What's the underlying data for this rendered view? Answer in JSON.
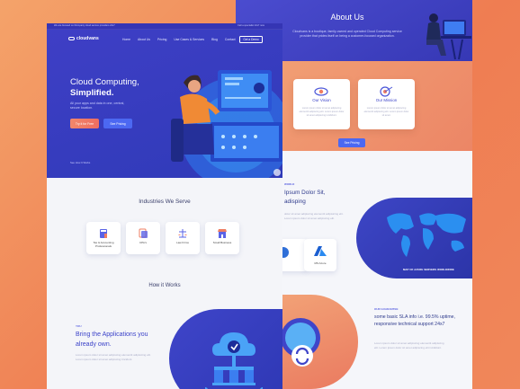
{
  "colors": {
    "primary": "#3b3fc3",
    "accent_orange": "#ee7a62",
    "button_blue": "#4c68f2",
    "background_gradient_start": "#f4a36a"
  },
  "page_a": {
    "topbar": {
      "left_text": "We are focused on third-party cloud service providers 24x7",
      "right_text": "Call a specialist 24x7 now"
    },
    "logo": "cloudvans",
    "nav": [
      "Home",
      "About Us",
      "Pricing",
      "Use Cases & Services",
      "Blog",
      "Contact"
    ],
    "nav_cta": "Get a Demo",
    "hero": {
      "title_line1": "Cloud Computing,",
      "title_line2": "Simplified.",
      "subtitle": "All your apps and data in one, central, secure location.",
      "primary_btn": "Try it for Free",
      "secondary_btn": "See Pricing",
      "see_how": "See How It Works"
    },
    "industries": {
      "title": "Industries We Serve",
      "items": [
        {
          "label": "Tax & Accounting Professionals",
          "icon": "calculator-icon"
        },
        {
          "label": "CPA's",
          "icon": "document-icon"
        },
        {
          "label": "Law Firms",
          "icon": "scales-icon"
        },
        {
          "label": "Small Business",
          "icon": "store-icon"
        }
      ]
    },
    "how": {
      "title": "How it Works",
      "eyebrow": "YOU",
      "headline": "Bring the Applications you already own.",
      "body": "Lorem ipsum dolor sit amet adipiscing elementit adipisicing elit. Lorem ipsum dolor sit amet adipiscing tincidunt."
    }
  },
  "page_b": {
    "about": {
      "title": "About Us",
      "text": "Cloudvans is a boutique, family-owned and operated Cloud Computing service provider that prides itself on being a customer-focused organization."
    },
    "vision": {
      "title": "Our Vision",
      "text": "Lorem ipsum dolor sit amet adipiscing elementit adipiscing elit. Lorem ipsum dolor sit amet adipiscing incididunt."
    },
    "mission": {
      "title": "Our Mission",
      "text": "Lorem ipsum dolor sit amet adipiscing elementit adipiscing elit. Lorem ipsum dolor sit amet."
    },
    "pricing_btn": "See Pricing",
    "servers": {
      "eyebrow": "WORLD",
      "headline": "Ipsum Dolor Sit, adisping",
      "body": "dolor sit amet adipiscing elementit adipisicing elit. Lorem ipsum dolor sit amet adipiscing elit.",
      "map_caption": "MAP OF AZURE SERVERS WORLDWIDE",
      "azure_label": "MS Azure"
    },
    "guarantee": {
      "eyebrow": "OUR GUARANTEE",
      "headline": "some basic SLA info i.e. 99.5% uptime, responsive technical support 24x7",
      "body": "Lorem ipsum dolor sit amet adipiscing elementit adipiscing elit. Lorem ipsum dolor sit amet adipiscing elit incididunt."
    }
  }
}
